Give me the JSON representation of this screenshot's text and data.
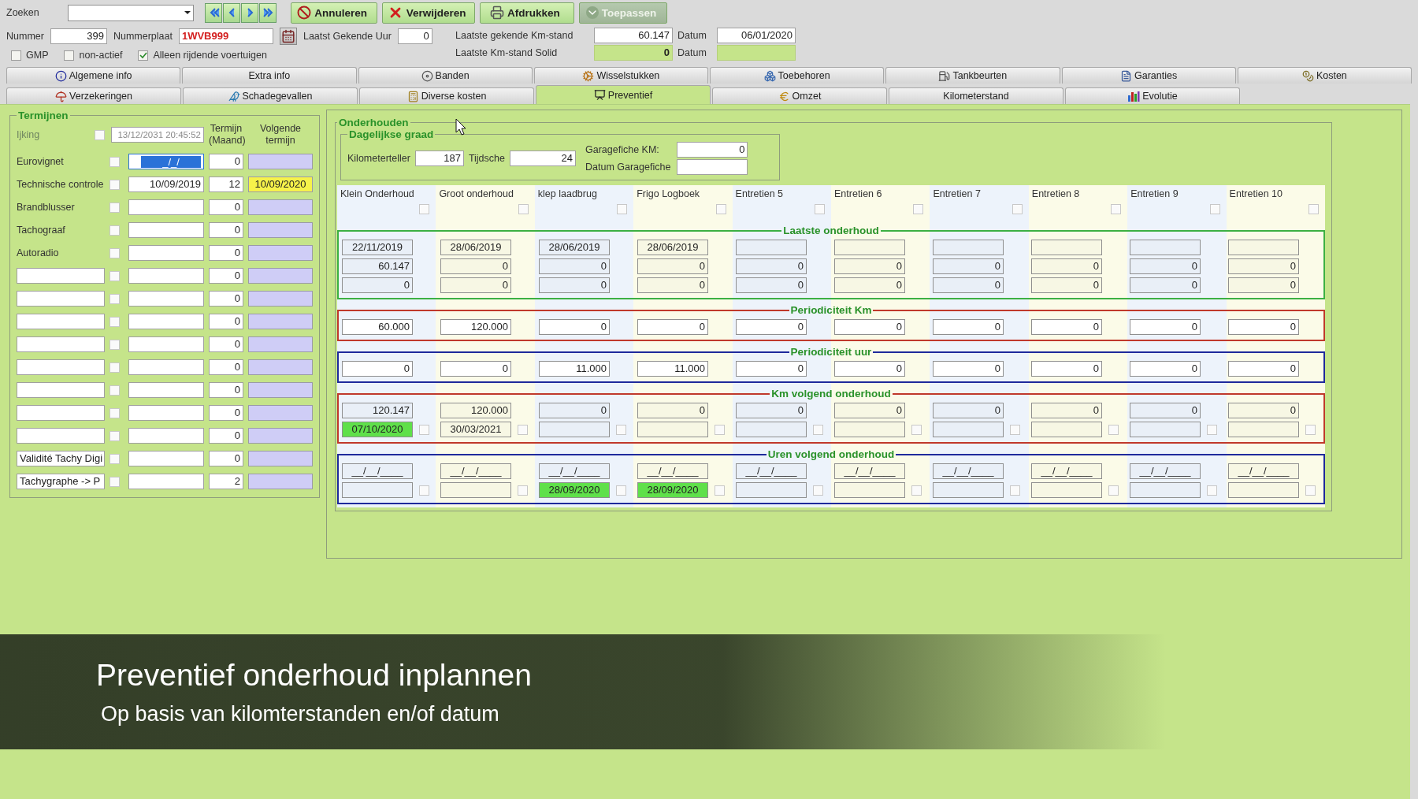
{
  "search": {
    "label": "Zoeken"
  },
  "nav_buttons": [
    {
      "kind": "first"
    },
    {
      "kind": "prev"
    },
    {
      "kind": "next"
    },
    {
      "kind": "last"
    }
  ],
  "actions": [
    {
      "label": "Annuleren",
      "kind": "cancel",
      "disabled": false
    },
    {
      "label": "Verwijderen",
      "kind": "delete",
      "disabled": false
    },
    {
      "label": "Afdrukken",
      "kind": "print",
      "disabled": false
    },
    {
      "label": "Toepassen",
      "kind": "apply",
      "disabled": true
    }
  ],
  "vehicle": {
    "number_label": "Nummer",
    "number": "399",
    "plate_label": "Nummerplaat",
    "plate": "1WVB999",
    "hours_label": "Laatst Gekende Uur",
    "hours": "0",
    "km_label": "Laatste gekende Km-stand",
    "km": "60.147",
    "km_date_label": "Datum",
    "km_date": "06/01/2020",
    "solid_label": "Laatste Km-stand Solid",
    "solid_km": "0",
    "solid_date_label": "Datum"
  },
  "filters": [
    {
      "label": "GMP",
      "checked": false
    },
    {
      "label": "non-actief",
      "checked": false
    },
    {
      "label": "Alleen rijdende voertuigen",
      "checked": true
    }
  ],
  "tab_rows": [
    {
      "tabs": [
        {
          "label": "Algemene info",
          "selected": false
        },
        {
          "label": "Extra info",
          "selected": false
        },
        {
          "label": "Banden",
          "selected": false
        },
        {
          "label": "Wisselstukken",
          "selected": false
        },
        {
          "label": "Toebehoren",
          "selected": false
        },
        {
          "label": "Tankbeurten",
          "selected": false
        },
        {
          "label": "Garanties",
          "selected": false
        },
        {
          "label": "Kosten",
          "selected": false
        }
      ]
    },
    {
      "tabs": [
        {
          "label": "Verzekeringen",
          "selected": false
        },
        {
          "label": "Schadegevallen",
          "selected": false
        },
        {
          "label": "Diverse kosten",
          "selected": false
        },
        {
          "label": "Preventief",
          "selected": true
        },
        {
          "label": "Omzet",
          "selected": false
        },
        {
          "label": "Kilometerstand",
          "selected": false
        },
        {
          "label": "Evolutie",
          "selected": false
        }
      ]
    }
  ],
  "terms": {
    "title": "Termijnen",
    "columns": [
      "Termijn (Maand)",
      "Volgende termijn"
    ],
    "rows": [
      {
        "kind": "disabled",
        "name": "Ijking",
        "checked": false,
        "date": "13/12/2031 20:45:52",
        "focused": false
      },
      {
        "kind": "label",
        "name": "Eurovignet",
        "checked": false,
        "date": "_/_/",
        "focused": true,
        "term": "0",
        "next_highlighted": false
      },
      {
        "kind": "label",
        "name": "Technische controle",
        "checked": false,
        "date": "10/09/2019",
        "focused": false,
        "term": "12",
        "next": "10/09/2020",
        "next_highlighted": true
      },
      {
        "kind": "label",
        "name": "Brandblusser",
        "checked": false,
        "focused": false,
        "term": "0",
        "next_highlighted": false
      },
      {
        "kind": "label",
        "name": "Tachograaf",
        "checked": false,
        "focused": false,
        "term": "0",
        "next_highlighted": false
      },
      {
        "kind": "label",
        "name": "Autoradio",
        "checked": false,
        "focused": false,
        "term": "0",
        "next_highlighted": false
      },
      {
        "kind": "field",
        "checked": false,
        "focused": false,
        "term": "0",
        "next_highlighted": false
      },
      {
        "kind": "field",
        "checked": false,
        "focused": false,
        "term": "0",
        "next_highlighted": false
      },
      {
        "kind": "field",
        "checked": false,
        "focused": false,
        "term": "0",
        "next_highlighted": false
      },
      {
        "kind": "field",
        "checked": false,
        "focused": false,
        "term": "0",
        "next_highlighted": false
      },
      {
        "kind": "field",
        "checked": false,
        "focused": false,
        "term": "0",
        "next_highlighted": false
      },
      {
        "kind": "field",
        "checked": false,
        "focused": false,
        "term": "0",
        "next_highlighted": false
      },
      {
        "kind": "field",
        "checked": false,
        "focused": false,
        "term": "0",
        "next_highlighted": false
      },
      {
        "kind": "field",
        "checked": false,
        "focused": false,
        "term": "0",
        "next_highlighted": false
      },
      {
        "kind": "field",
        "name": "Validité Tachy Digi",
        "checked": false,
        "focused": false,
        "term": "0",
        "next_highlighted": false
      },
      {
        "kind": "field",
        "name": "Tachygraphe -> P",
        "checked": false,
        "focused": false,
        "term": "2",
        "next_highlighted": false
      }
    ]
  },
  "maintenance": {
    "title": "Onderhouden",
    "daily": {
      "title": "Dagelijkse graad",
      "km_label": "Kilometerteller",
      "km": "187",
      "time_label": "Tijdsche",
      "time": "24",
      "garage_km_label": "Garagefiche KM:",
      "garage_km": "0",
      "garage_date_label": "Datum Garagefiche"
    },
    "columns": [
      {
        "name": "Klein Onderhoud",
        "checked": false
      },
      {
        "name": "Groot onderhoud",
        "checked": false
      },
      {
        "name": "klep laadbrug",
        "checked": false
      },
      {
        "name": "Frigo Logboek",
        "checked": false
      },
      {
        "name": "Entretien 5",
        "checked": false
      },
      {
        "name": "Entretien 6",
        "checked": false
      },
      {
        "name": "Entretien 7",
        "checked": false
      },
      {
        "name": "Entretien 8",
        "checked": false
      },
      {
        "name": "Entretien 9",
        "checked": false
      },
      {
        "name": "Entretien 10",
        "checked": false
      }
    ],
    "sections": [
      {
        "title": "Laatste onderhoud",
        "color": "#3cb043",
        "rows": [
          {
            "kind": "plain",
            "editable": false,
            "cells": [
              {
                "value": "22/11/2019"
              },
              {
                "value": "28/06/2019"
              },
              {
                "value": "28/06/2019"
              },
              {
                "value": "28/06/2019"
              },
              {},
              {},
              {},
              {},
              {},
              {}
            ]
          },
          {
            "kind": "plain",
            "editable": false,
            "cells": [
              {
                "value": "60.147"
              },
              {
                "value": "0"
              },
              {
                "value": "0"
              },
              {
                "value": "0"
              },
              {
                "value": "0"
              },
              {
                "value": "0"
              },
              {
                "value": "0"
              },
              {
                "value": "0"
              },
              {
                "value": "0"
              },
              {
                "value": "0"
              }
            ]
          },
          {
            "kind": "plain",
            "editable": false,
            "cells": [
              {
                "value": "0"
              },
              {
                "value": "0"
              },
              {
                "value": "0"
              },
              {
                "value": "0"
              },
              {
                "value": "0"
              },
              {
                "value": "0"
              },
              {
                "value": "0"
              },
              {
                "value": "0"
              },
              {
                "value": "0"
              },
              {
                "value": "0"
              }
            ]
          }
        ]
      },
      {
        "title": "Periodiciteit Km",
        "color": "#c0392b",
        "rows": [
          {
            "kind": "plain",
            "editable": true,
            "cells": [
              {
                "value": "60.000"
              },
              {
                "value": "120.000"
              },
              {
                "value": "0"
              },
              {
                "value": "0"
              },
              {
                "value": "0"
              },
              {
                "value": "0"
              },
              {
                "value": "0"
              },
              {
                "value": "0"
              },
              {
                "value": "0"
              },
              {
                "value": "0"
              }
            ]
          }
        ]
      },
      {
        "title": "Periodiciteit uur",
        "color": "#1f2a9c",
        "rows": [
          {
            "kind": "plain",
            "editable": true,
            "cells": [
              {
                "value": "0"
              },
              {
                "value": "0"
              },
              {
                "value": "11.000"
              },
              {
                "value": "11.000"
              },
              {
                "value": "0"
              },
              {
                "value": "0"
              },
              {
                "value": "0"
              },
              {
                "value": "0"
              },
              {
                "value": "0"
              },
              {
                "value": "0"
              }
            ]
          }
        ]
      },
      {
        "title": "Km volgend onderhoud",
        "color": "#c0392b",
        "rows": [
          {
            "kind": "plain",
            "editable": false,
            "cells": [
              {
                "value": "120.147"
              },
              {
                "value": "120.000"
              },
              {
                "value": "0"
              },
              {
                "value": "0"
              },
              {
                "value": "0"
              },
              {
                "value": "0"
              },
              {
                "value": "0"
              },
              {
                "value": "0"
              },
              {
                "value": "0"
              },
              {
                "value": "0"
              }
            ]
          },
          {
            "kind": "check",
            "editable": false,
            "cells": [
              {
                "value": "07/10/2020",
                "highlighted": true,
                "checked": false
              },
              {
                "value": "30/03/2021",
                "highlighted": false,
                "checked": false
              },
              {
                "highlighted": false,
                "checked": false
              },
              {
                "highlighted": false,
                "checked": false
              },
              {
                "highlighted": false,
                "checked": false
              },
              {
                "highlighted": false,
                "checked": false
              },
              {
                "highlighted": false,
                "checked": false
              },
              {
                "highlighted": false,
                "checked": false
              },
              {
                "highlighted": false,
                "checked": false
              },
              {
                "highlighted": false,
                "checked": false
              }
            ]
          }
        ]
      },
      {
        "title": "Uren volgend onderhoud",
        "color": "#1f2a9c",
        "rows": [
          {
            "kind": "plain",
            "editable": false,
            "cells": [
              {
                "value": "__/__/____"
              },
              {
                "value": "__/__/____"
              },
              {
                "value": "__/__/____"
              },
              {
                "value": "__/__/____"
              },
              {
                "value": "__/__/____"
              },
              {
                "value": "__/__/____"
              },
              {
                "value": "__/__/____"
              },
              {
                "value": "__/__/____"
              },
              {
                "value": "__/__/____"
              },
              {
                "value": "__/__/____"
              }
            ]
          },
          {
            "kind": "check",
            "editable": false,
            "cells": [
              {
                "highlighted": false,
                "checked": false
              },
              {
                "highlighted": false,
                "checked": false
              },
              {
                "value": "28/09/2020",
                "highlighted": true,
                "checked": false
              },
              {
                "value": "28/09/2020",
                "highlighted": true,
                "checked": false
              },
              {
                "highlighted": false,
                "checked": false
              },
              {
                "highlighted": false,
                "checked": false
              },
              {
                "highlighted": false,
                "checked": false
              },
              {
                "highlighted": false,
                "checked": false
              },
              {
                "highlighted": false,
                "checked": false
              },
              {
                "highlighted": false,
                "checked": false
              }
            ]
          }
        ]
      }
    ]
  },
  "caption": {
    "title": "Preventief onderhoud inplannen",
    "subtitle": "Op basis van kilomterstanden en/of datum"
  }
}
